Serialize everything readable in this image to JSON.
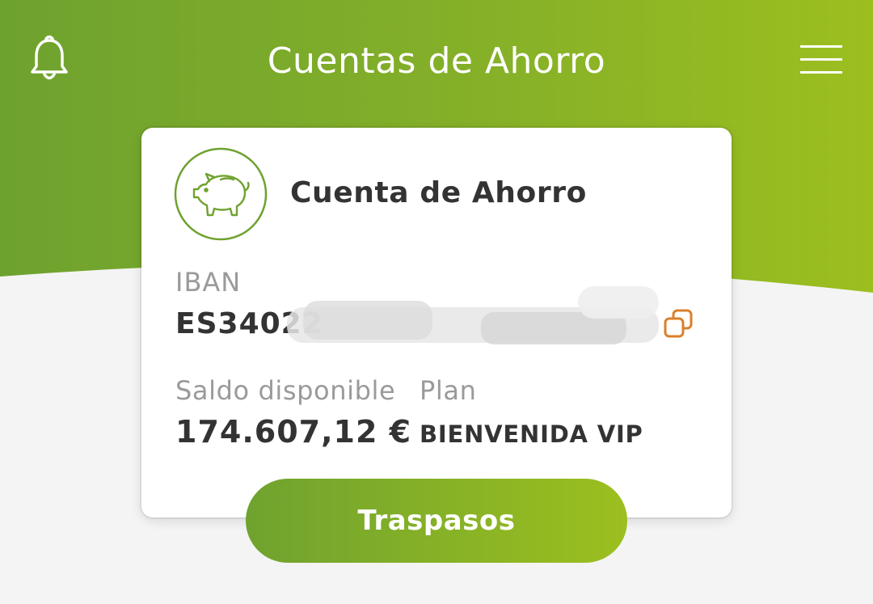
{
  "header": {
    "title": "Cuentas de Ahorro",
    "bell_icon": "bell-icon",
    "menu_icon": "hamburger-menu-icon"
  },
  "account_card": {
    "icon": "piggy-bank-icon",
    "title": "Cuenta de Ahorro",
    "iban_label": "IBAN",
    "iban_value": "ES34022",
    "copy_icon": "copy-icon",
    "balance_label": "Saldo disponible",
    "balance_value": "174.607,12 €",
    "plan_label": "Plan",
    "plan_value": "BIENVENIDA VIP"
  },
  "actions": {
    "transfer_label": "Traspasos"
  },
  "colors": {
    "brand_green_dark": "#6fa22f",
    "brand_green_light": "#9cbf1f",
    "copy_accent": "#d9802a",
    "text_dark": "#333333",
    "text_muted": "#9a9a9a",
    "background": "#f4f4f4"
  }
}
